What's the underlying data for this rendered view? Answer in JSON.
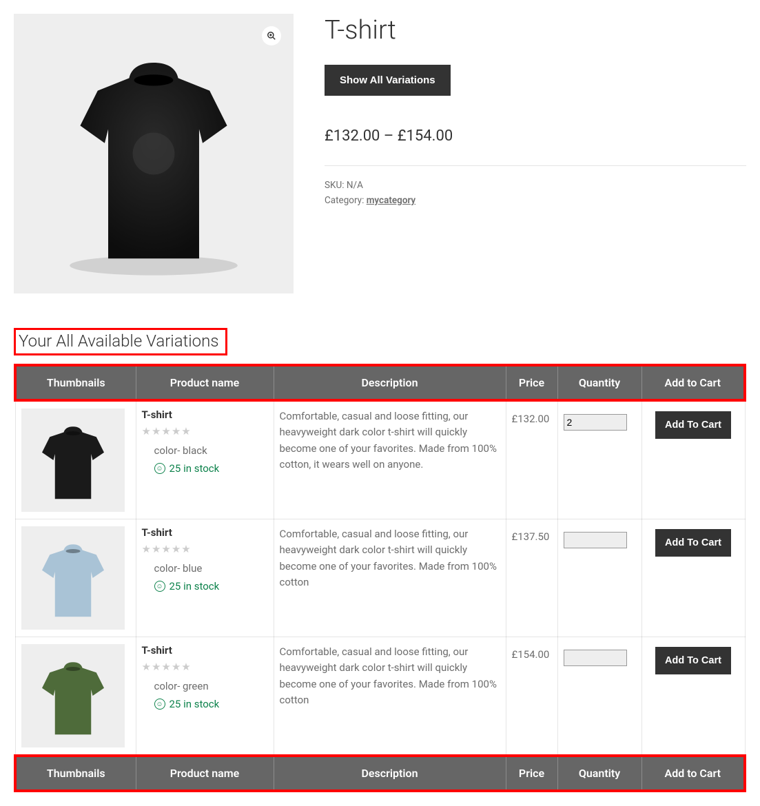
{
  "product": {
    "title": "T-shirt",
    "show_variations_btn": "Show All Variations",
    "price_range": "£132.00 – £154.00",
    "sku_label": "SKU:",
    "sku_value": "N/A",
    "category_label": "Category:",
    "category_value": "mycategory"
  },
  "section_title": "Your All Available Variations",
  "table": {
    "headers": {
      "thumb": "Thumbnails",
      "name": "Product name",
      "desc": "Description",
      "price": "Price",
      "qty": "Quantity",
      "cart": "Add to Cart"
    },
    "rows": [
      {
        "name": "T-shirt",
        "attr": "color- black",
        "stock": "25 in stock",
        "desc": "Comfortable, casual and loose fitting, our heavyweight dark color t-shirt will quickly become one of your favorites. Made from 100% cotton, it wears well on anyone.",
        "price": "£132.00",
        "qty": "2",
        "cart_label": "Add To Cart",
        "color": "#1a1a1a"
      },
      {
        "name": "T-shirt",
        "attr": "color- blue",
        "stock": "25 in stock",
        "desc": "Comfortable, casual and loose fitting, our heavyweight dark color t-shirt will quickly become one of your favorites. Made from 100% cotton",
        "price": "£137.50",
        "qty": "",
        "cart_label": "Add To Cart",
        "color": "#a9c3d6"
      },
      {
        "name": "T-shirt",
        "attr": "color- green",
        "stock": "25 in stock",
        "desc": "Comfortable, casual and loose fitting, our heavyweight dark color t-shirt will quickly become one of your favorites. Made from 100% cotton",
        "price": "£154.00",
        "qty": "",
        "cart_label": "Add To Cart",
        "color": "#4e6b3a"
      }
    ]
  }
}
